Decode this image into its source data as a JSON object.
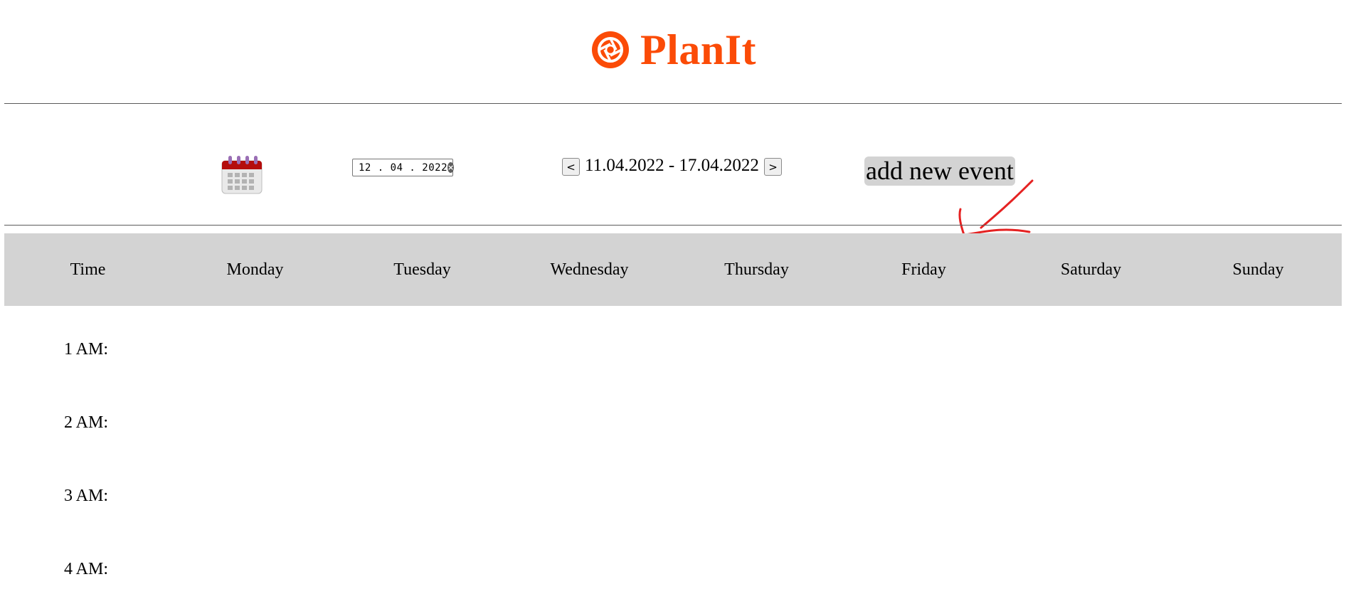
{
  "app": {
    "name": "PlanIt",
    "brand_color": "#fb4b07",
    "logo_icon": "aperture-icon"
  },
  "toolbar": {
    "calendar_icon": "calendar-icon",
    "date_value": "12 . 04 . 2022",
    "clear_icon": "clear-icon",
    "prev_label": "<",
    "next_label": ">",
    "week_range": "11.04.2022 - 17.04.2022",
    "add_event_label": "add new event",
    "annotation": "red hand-drawn arrow pointing to add new event"
  },
  "schedule": {
    "header_bg": "#d3d3d3",
    "columns": [
      "Time",
      "Monday",
      "Tuesday",
      "Wednesday",
      "Thursday",
      "Friday",
      "Saturday",
      "Sunday"
    ],
    "rows": [
      {
        "time": "1 AM:"
      },
      {
        "time": "2 AM:"
      },
      {
        "time": "3 AM:"
      },
      {
        "time": "4 AM:"
      }
    ]
  }
}
